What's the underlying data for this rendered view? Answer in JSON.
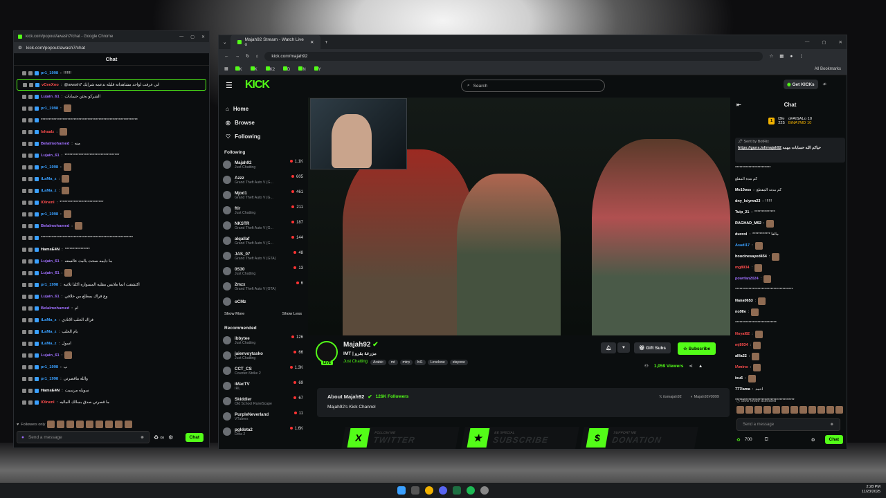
{
  "popout": {
    "title": "kick.com/popout/awash7/chat - Google Chrome",
    "url": "kick.com/popout/awash7/chat",
    "header": "Chat",
    "messages": [
      {
        "user": "pr1_1998",
        "text": "!!!!!!!",
        "color": "#3aa0ff"
      },
      {
        "user": "vCeeXoo",
        "text": "@awash7 اني عرفت لواحد مشاهداته قليله تدعمه شرايك",
        "color": "#ff4d4d",
        "hl": true
      },
      {
        "user": "Lujain_61",
        "text": "الشركو بحثن حسابات",
        "color": "#a070ff"
      },
      {
        "user": "pr1_1998",
        "text": "",
        "color": "#3aa0ff"
      },
      {
        "user": "",
        "text": "**************************************************************",
        "color": "#fff"
      },
      {
        "user": "Ishaalz",
        "text": "",
        "color": "#ff4d4d"
      },
      {
        "user": "Belalmohamed",
        "text": "منه",
        "color": "#a070ff"
      },
      {
        "user": "Lujain_61",
        "text": "***********************************",
        "color": "#a070ff"
      },
      {
        "user": "pr1_1998",
        "text": "",
        "color": "#3aa0ff"
      },
      {
        "user": "iLaMa_z",
        "text": "",
        "color": "#3aa0ff"
      },
      {
        "user": "iLaMa_z",
        "text": "",
        "color": "#3aa0ff"
      },
      {
        "user": "lOlnenl",
        "text": "****************************",
        "color": "#ff4d4d"
      },
      {
        "user": "pr1_1998",
        "text": "",
        "color": "#3aa0ff"
      },
      {
        "user": "Belalmohamed",
        "text": "",
        "color": "#a070ff"
      },
      {
        "user": "",
        "text": "***********************************************************",
        "color": "#fff"
      },
      {
        "user": "HamsE4N",
        "text": "****************",
        "color": "#fff"
      },
      {
        "user": "Lujain_61",
        "text": "ما دايمه صحت بالبث عالسعه",
        "color": "#a070ff"
      },
      {
        "user": "Lujain_61",
        "text": "",
        "color": "#a070ff"
      },
      {
        "user": "pr1_1998",
        "text": "اكتشفت انما ملابس مقليه المسواره اكلنا تلاتيه",
        "color": "#3aa0ff"
      },
      {
        "user": "Lujain_61",
        "text": "وع فراك بمطلع من خلافي",
        "color": "#a070ff"
      },
      {
        "user": "Belalmohamed",
        "text": "ام",
        "color": "#a070ff"
      },
      {
        "user": "iLaMa_z",
        "text": "فراك الحلب الاتادي",
        "color": "#3aa0ff"
      },
      {
        "user": "iLaMa_z",
        "text": "بام الحلب",
        "color": "#3aa0ff"
      },
      {
        "user": "iLaMa_z",
        "text": "اسول",
        "color": "#3aa0ff"
      },
      {
        "user": "Lujain_61",
        "text": "",
        "color": "#a070ff"
      },
      {
        "user": "pr1_1998",
        "text": "ب",
        "color": "#3aa0ff"
      },
      {
        "user": "pr1_1998",
        "text": "والله ماقصرتي",
        "color": "#3aa0ff"
      },
      {
        "user": "HamsE4N",
        "text": "سويله مرسيت",
        "color": "#fff"
      },
      {
        "user": "lOlnenl",
        "text": "ما قصرتي صدق بسالك الماليه",
        "color": "#ff4d4d"
      }
    ],
    "followers_only": "Followers only",
    "input_placeholder": "Send a message",
    "chat_btn": "Chat"
  },
  "main": {
    "tab_title": "Majah92 Stream - Watch Live o",
    "url": "kick.com/majah92",
    "bookmarks": [
      "K",
      "K",
      "K2",
      "D",
      "N",
      "Y"
    ],
    "all_bookmarks": "All Bookmarks",
    "search_placeholder": "Search",
    "get_kicks": "Get KICKs",
    "nav": [
      {
        "label": "Home",
        "icon": "home-icon"
      },
      {
        "label": "Browse",
        "icon": "compass-icon"
      },
      {
        "label": "Following",
        "icon": "heart-icon"
      }
    ],
    "following_header": "Following",
    "following": [
      {
        "name": "Majah92",
        "game": "Just Chatting",
        "viewers": "1.1K"
      },
      {
        "name": "Azzz",
        "game": "Grand Theft Auto V (G...",
        "viewers": "605"
      },
      {
        "name": "Mjod1",
        "game": "Grand Theft Auto V (G...",
        "viewers": "461"
      },
      {
        "name": "ftir",
        "game": "Just Chatting",
        "viewers": "211"
      },
      {
        "name": "NKSTR",
        "game": "Grand Theft Auto V (G...",
        "viewers": "187"
      },
      {
        "name": "alqallaf",
        "game": "Grand Theft Auto V (G...",
        "viewers": "144"
      },
      {
        "name": "JAS_07",
        "game": "Grand Theft Auto V (GTA)",
        "viewers": "48"
      },
      {
        "name": "0S30",
        "game": "Just Chatting",
        "viewers": "13"
      },
      {
        "name": "2mzx",
        "game": "Grand Theft Auto V (GTA)",
        "viewers": "6"
      },
      {
        "name": "oCMz",
        "game": "",
        "viewers": ""
      }
    ],
    "show_more": "Show More",
    "show_less": "Show Less",
    "recommended_header": "Recommended",
    "recommended": [
      {
        "name": "ibbytee",
        "game": "Just Chatting",
        "viewers": "126"
      },
      {
        "name": "jaienvoytasko",
        "game": "Just Chatting",
        "viewers": "66"
      },
      {
        "name": "CCT_CS",
        "game": "Counter-Strike 2",
        "viewers": "1.3K"
      },
      {
        "name": "iMacTV",
        "game": "IRL",
        "viewers": "69"
      },
      {
        "name": "Skiddler",
        "game": "Old School RuneScape",
        "viewers": "67"
      },
      {
        "name": "PurpleNeverland",
        "game": "VTubers",
        "viewers": "11"
      },
      {
        "name": "pgldota2",
        "game": "Dota 2",
        "viewers": "1.6K"
      }
    ],
    "streamer": "Majah92",
    "stream_title": "IMT | مزرعة بقرو",
    "category": "Just Chatting",
    "tags": [
      "Arabic",
      "mt",
      "mtrp",
      "lvl1",
      "Levelone",
      "stayone"
    ],
    "gift_subs": "Gift Subs",
    "subscribe": "Subscribe",
    "viewers": "1,059 Viewers",
    "about_title": "About Majah92",
    "followers": "126K Followers",
    "about_text": "Majah92's Kick Channel",
    "social_x": "itsmajah92",
    "social_d": "Majah92#9999",
    "panels": [
      {
        "top": "FOLLOW ME",
        "text": "TWITTER",
        "icon": "X"
      },
      {
        "top": "BE SPECIAL",
        "text": "SUBSCRIBE",
        "icon": "★"
      },
      {
        "top": "SUPPORT ME",
        "text": "DONATION",
        "icon": "$"
      }
    ],
    "live_badge": "LIVE"
  },
  "right_chat": {
    "header": "Chat",
    "leaderboard": [
      {
        "rank": "1",
        "name": "l3fe",
        "count": "225"
      },
      {
        "name": "oFAISALo",
        "count": "10"
      },
      {
        "name": "BiNA7MD",
        "count": "10"
      }
    ],
    "pinned_sender": "Sent by BotRix",
    "pinned_link": "https://guns.lol/majah92",
    "pinned_text": "حياكم الله حسابات مهمه",
    "messages": [
      {
        "user": "",
        "text": "************************",
        "color": "#fff"
      },
      {
        "user": "",
        "text": "كم مدة المقلع",
        "color": "#fff"
      },
      {
        "user": "Me10oss",
        "text": "كم مدته المقطع",
        "color": "#fff"
      },
      {
        "user": "dny_lsiymn23",
        "text": "!!!!!!",
        "color": "#fff"
      },
      {
        "user": "Tuip_21",
        "text": "**************",
        "color": "#fff"
      },
      {
        "user": "RAGHAD_M92",
        "text": "",
        "color": "#fff"
      },
      {
        "user": "duxxxl",
        "text": "************ مالغا",
        "color": "#fff"
      },
      {
        "user": "Asadi17",
        "text": "",
        "color": "#3aa0ff"
      },
      {
        "user": "houcinesayed454",
        "text": "",
        "color": "#fff"
      },
      {
        "user": "mg8934",
        "text": "",
        "color": "#ff4d4d"
      },
      {
        "user": "powrfan2024",
        "text": "",
        "color": "#a070ff"
      },
      {
        "user": "",
        "text": "***************************************",
        "color": "#fff"
      },
      {
        "user": "Nana0653",
        "text": "",
        "color": "#fff"
      },
      {
        "user": "no9lle",
        "text": "",
        "color": "#fff"
      },
      {
        "user": "",
        "text": "****************************",
        "color": "#fff"
      },
      {
        "user": "Noyal82",
        "text": "",
        "color": "#ff4d4d"
      },
      {
        "user": "mj8934",
        "text": "",
        "color": "#ff4d4d"
      },
      {
        "user": "allla22",
        "text": "",
        "color": "#fff"
      },
      {
        "user": "lAmino",
        "text": "",
        "color": "#ff4d4d"
      },
      {
        "user": "ixu6",
        "text": "",
        "color": "#fff"
      },
      {
        "user": "777lama",
        "text": "احمد",
        "color": "#fff"
      },
      {
        "user": "",
        "text": "****************************************",
        "color": "#fff"
      }
    ],
    "slow_mode": "Slow mode activated",
    "input_placeholder": "Send a message",
    "points": "700",
    "chat_btn": "Chat"
  },
  "taskbar": {
    "time": "2:28 PM",
    "date": "11/23/2025"
  }
}
